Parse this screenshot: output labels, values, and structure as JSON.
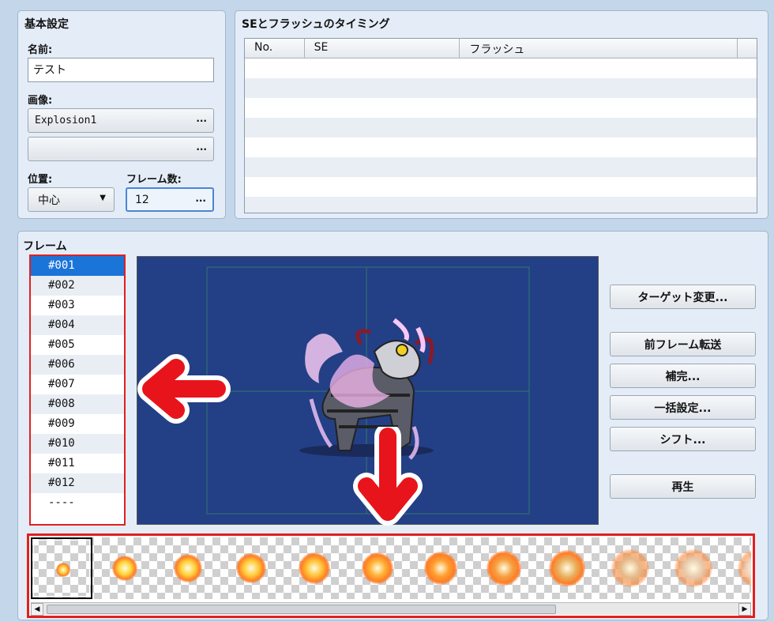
{
  "basic": {
    "title": "基本設定",
    "name_label": "名前:",
    "name_value": "テスト",
    "image_label": "画像:",
    "image1": "Explosion1",
    "image2": "",
    "dots": "...",
    "position_label": "位置:",
    "position_value": "中心",
    "frames_label": "フレーム数:",
    "frames_value": "12"
  },
  "se": {
    "title": "SEとフラッシュのタイミング",
    "columns": [
      "No.",
      "SE",
      "フラッシュ"
    ],
    "rows": 8
  },
  "frame": {
    "title": "フレーム",
    "items": [
      "#001",
      "#002",
      "#003",
      "#004",
      "#005",
      "#006",
      "#007",
      "#008",
      "#009",
      "#010",
      "#011",
      "#012",
      "----"
    ],
    "selected_index": 0
  },
  "buttons": {
    "target_change": "ターゲット変更...",
    "prev_frame_copy": "前フレーム転送",
    "tween": "補完...",
    "batch_settings": "一括設定...",
    "shift": "シフト...",
    "play": "再生"
  },
  "strip": {
    "cell_count": 12,
    "selected_index": 0,
    "scroll_fraction": 0.74
  },
  "colors": {
    "highlight_red": "#e02020",
    "selection_blue": "#1b74d8",
    "preview_bg": "#233f86"
  },
  "icons": {
    "dropdown": "triangle-down-icon",
    "scroll_left": "triangle-left-icon",
    "scroll_right": "triangle-right-icon",
    "arrow_left": "red-arrow-left-icon",
    "arrow_down": "red-arrow-down-icon"
  }
}
